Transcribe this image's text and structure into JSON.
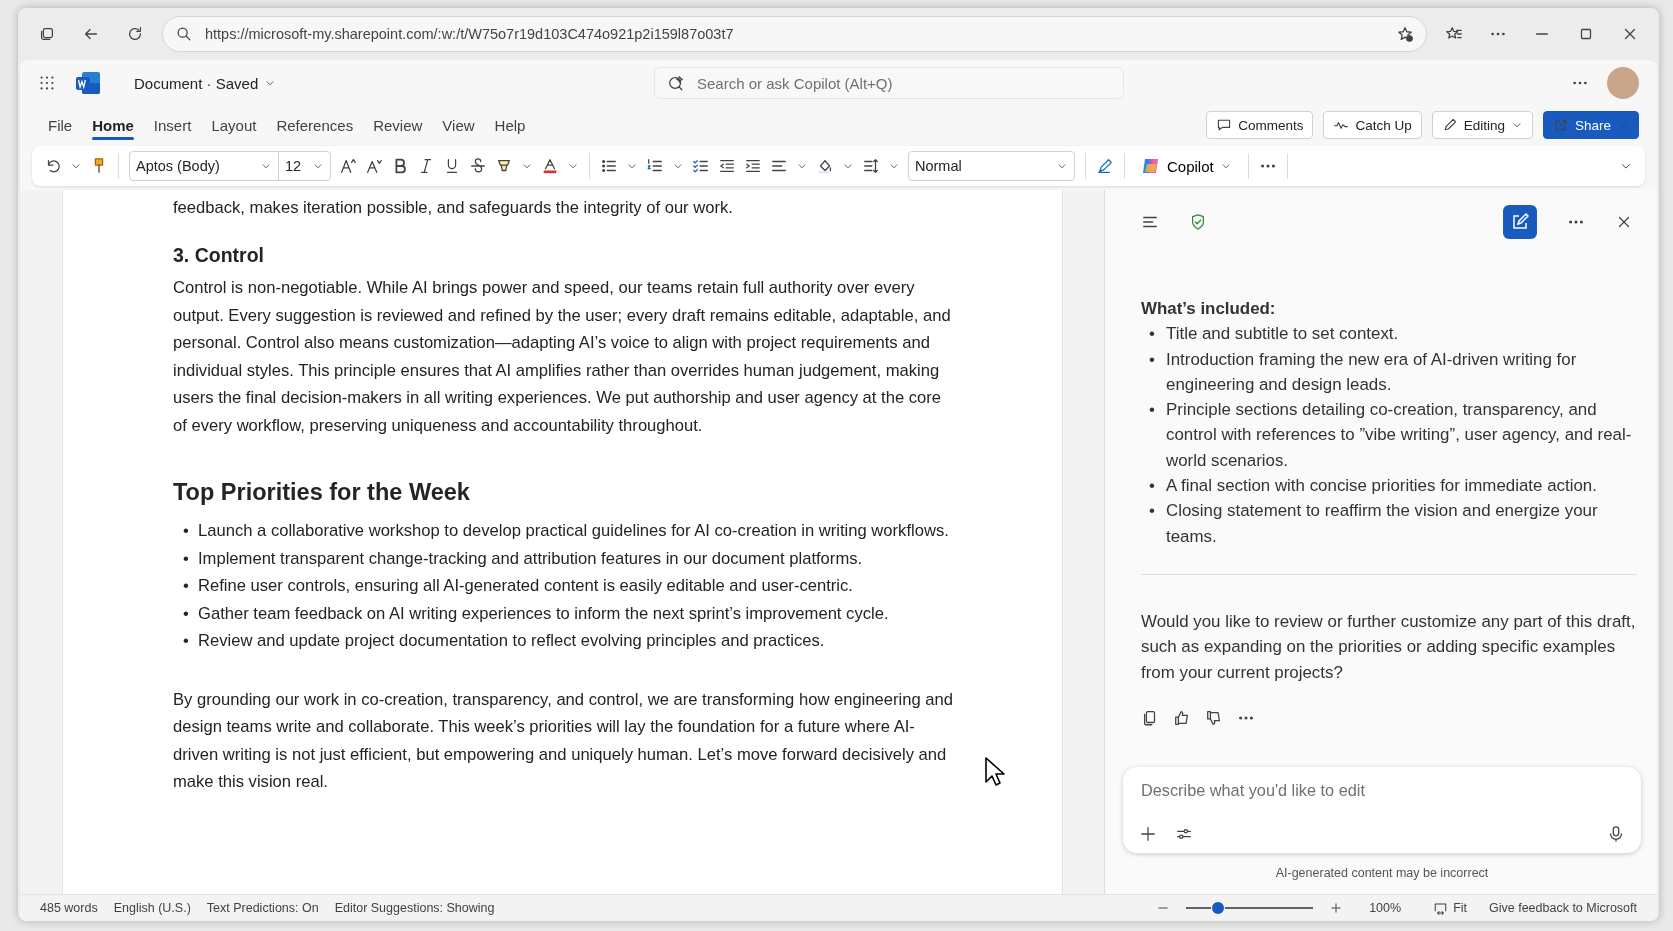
{
  "browser": {
    "url": "https://microsoft-my.sharepoint.com/:w:/t/W75o7r19d103C474o921p2i159l87o03t7"
  },
  "app": {
    "document_title": "Document · Saved",
    "search": {
      "placeholder": "Search or ask Copilot (Alt+Q)"
    }
  },
  "tabs": [
    {
      "label": "File",
      "selected": false
    },
    {
      "label": "Home",
      "selected": true
    },
    {
      "label": "Insert",
      "selected": false
    },
    {
      "label": "Layout",
      "selected": false
    },
    {
      "label": "References",
      "selected": false
    },
    {
      "label": "Review",
      "selected": false
    },
    {
      "label": "View",
      "selected": false
    },
    {
      "label": "Help",
      "selected": false
    }
  ],
  "actions": [
    {
      "label": "Comments",
      "kind": "comments"
    },
    {
      "label": "Catch Up",
      "kind": "catchup"
    },
    {
      "label": "Editing",
      "kind": "editing"
    },
    {
      "label": "Share",
      "kind": "share"
    }
  ],
  "ribbon": {
    "font": "Aptos (Body)",
    "size": "12",
    "style": "Normal",
    "copilot": "Copilot"
  },
  "document": [
    {
      "kind": "para",
      "text": "feedback, makes iteration possible, and safeguards the integrity of our work."
    },
    {
      "kind": "h3",
      "text": "3. Control"
    },
    {
      "kind": "para",
      "text": "Control is non-negotiable. While AI brings power and speed, our teams retain full authority over every output. Every suggestion is reviewed and refined by the user; every draft remains editable, adaptable, and personal. Control also means customization—adapting AI’s voice to align with project requirements and individual styles. This principle ensures that AI amplifies rather than overrides human judgement, making users the final decision-makers in all writing experiences. We put authorship and user agency at the core of every workflow, preserving uniqueness and accountability throughout."
    },
    {
      "kind": "h2",
      "text": "Top Priorities for the Week"
    },
    {
      "kind": "bullets",
      "marker": "•",
      "items": [
        "Launch a collaborative workshop to develop practical guidelines for AI co-creation in writing workflows.",
        "Implement transparent change-tracking and attribution features in our document platforms.",
        "Refine user controls, ensuring all AI-generated content is easily editable and user-centric.",
        "Gather team feedback on AI writing experiences to inform the next sprint’s improvement cycle.",
        "Review and update project documentation to reflect evolving principles and practices."
      ]
    },
    {
      "kind": "para",
      "text": "By grounding our work in co-creation, transparency, and control, we are transforming how engineering and design teams write and collaborate. This week’s priorities will lay the foundation for a future where AI-driven writing is not just efficient, but empowering and uniquely human. Let’s move forward decisively and make this vision real."
    }
  ],
  "copilot": {
    "heading": "What’s included:",
    "marker": "•",
    "items": [
      "Title and subtitle to set context.",
      "Introduction framing the new era of AI-driven writing for engineering and design leads.",
      "Principle sections detailing co-creation, transparency, and control with references to ”vibe writing”, user agency, and real-world scenarios.",
      "A final section with concise priorities for immediate action.",
      "Closing statement to reaffirm the vision and energize your teams."
    ],
    "question": "Would you like to review or further customize any part of this draft, such as expanding on the priorities or adding specific examples from your current projects?",
    "input": {
      "placeholder": "Describe what you'd like to edit"
    },
    "disclaimer": "AI-generated content may be incorrect"
  },
  "status_bar": {
    "items": [
      "485 words",
      "English (U.S.)",
      "Text Predictions: On",
      "Editor Suggestions: Showing"
    ],
    "zoom": {
      "level": 0.25,
      "reading": "100%"
    },
    "fit": "Fit",
    "feedback": "Give feedback to Microsoft"
  }
}
